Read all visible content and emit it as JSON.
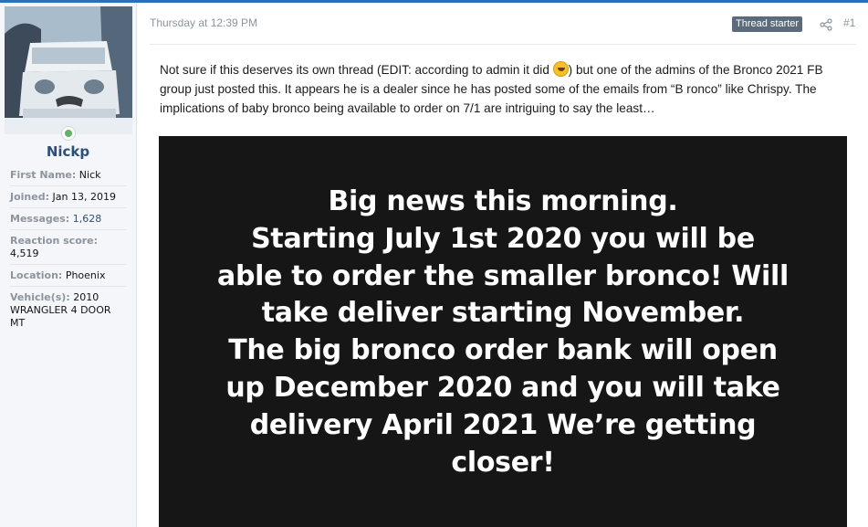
{
  "post": {
    "timestamp": "Thursday at 12:39 PM",
    "badge": "Thread starter",
    "number": "#1",
    "share_icon": "share-icon"
  },
  "user": {
    "name": "Nickp",
    "online": true,
    "avatar": "avatar-image",
    "fields": [
      {
        "term": "First Name:",
        "value": "Nick"
      },
      {
        "term": "Joined:",
        "value": "Jan 13, 2019"
      },
      {
        "term": "Messages:",
        "value": "1,628"
      },
      {
        "term": "Reaction score:",
        "value": "4,519"
      },
      {
        "term": "Location:",
        "value": "Phoenix"
      },
      {
        "term": "Vehicle(s):",
        "value": "2010 WRANGLER 4 DOOR MT"
      }
    ]
  },
  "message": {
    "text_before_emoji": "Not sure if this deserves its own thread (EDIT: according to admin it did ",
    "emoji": "rofl-emoji",
    "text_after_emoji": ") but one of the admins of the Bronco 2021 FB group just posted this. It appears he is a dealer since he has posted some of the emails from “B ronco” like Chrispy. The implications of baby bronco being available to order on 7/1 are intriguing to say the least…"
  },
  "image_text": {
    "lines": [
      "Big news this morning.",
      "Starting July 1st 2020 you will be",
      "able to order the smaller bronco! Will",
      "take deliver starting November.",
      "The big bronco order bank will open",
      "up December 2020 and you will take",
      "delivery April 2021 We’re getting",
      "closer!"
    ]
  },
  "colors": {
    "accent": "#2f6fb5",
    "username": "#2c4f7c",
    "badge_bg": "#5c6b7a",
    "image_bg": "#161616",
    "online": "#63b265"
  }
}
